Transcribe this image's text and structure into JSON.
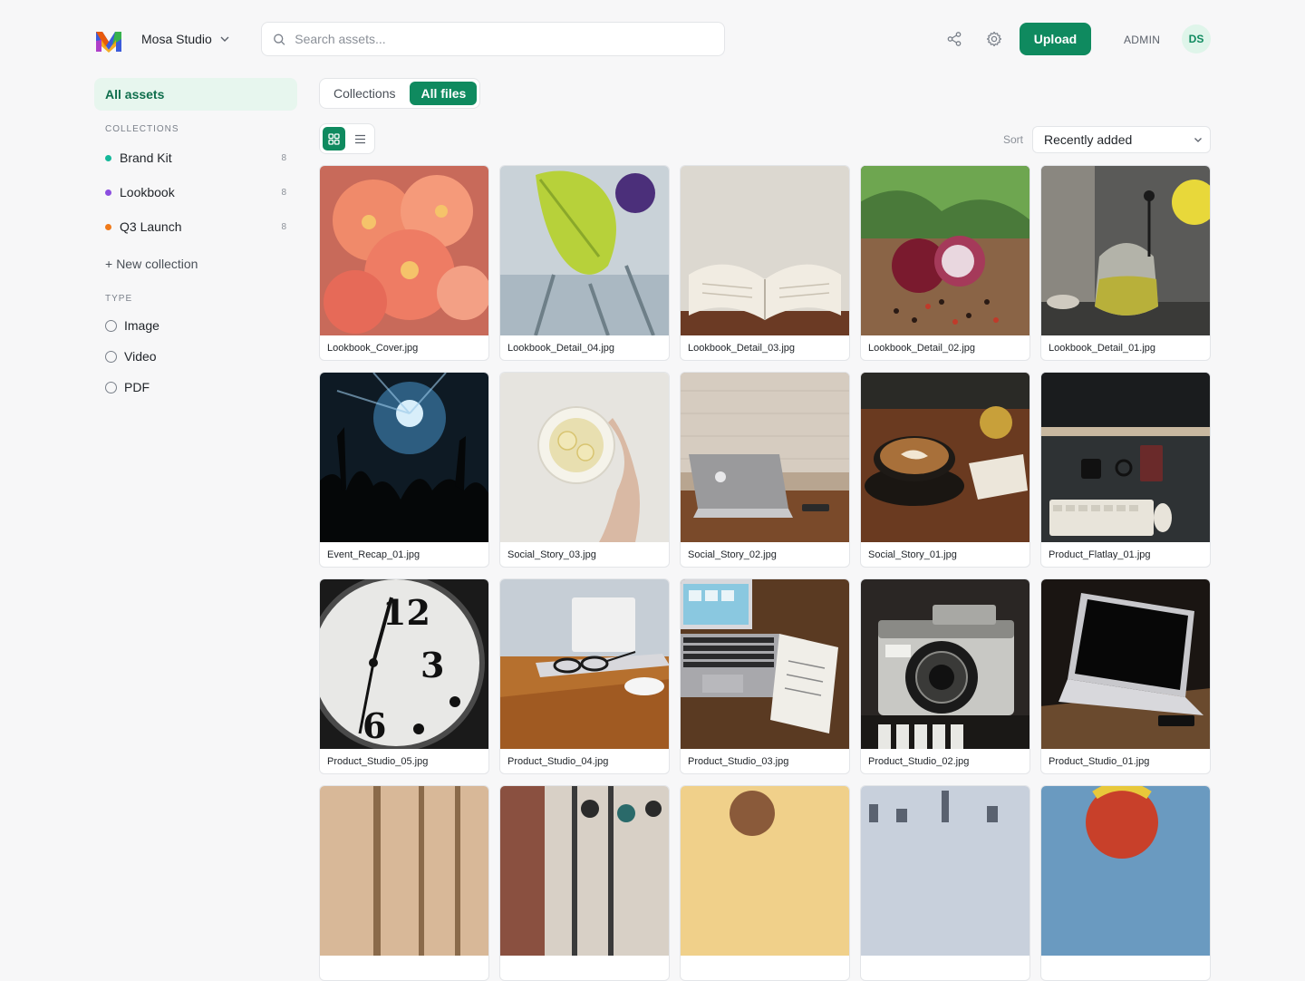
{
  "header": {
    "workspace_name": "Mosa Studio",
    "search_placeholder": "Search assets...",
    "upload_label": "Upload",
    "role": "ADMIN",
    "avatar_initials": "DS",
    "icons": [
      "share-icon",
      "settings-icon",
      "search-icon",
      "chevron-down-icon"
    ],
    "accent_color": "#0f8a5f"
  },
  "sidebar": {
    "all_assets": "All assets",
    "collections_heading": "COLLECTIONS",
    "collections": [
      {
        "name": "Brand Kit",
        "count": "8",
        "color": "#14b89a"
      },
      {
        "name": "Lookbook",
        "count": "8",
        "color": "#8b4ee0"
      },
      {
        "name": "Q3 Launch",
        "count": "8",
        "color": "#f07a1a"
      }
    ],
    "new_collection": "New collection",
    "type_heading": "TYPE",
    "types": [
      "Image",
      "Video",
      "PDF"
    ]
  },
  "main": {
    "tabs": [
      "Collections",
      "All files"
    ],
    "active_tab": "All files",
    "view_modes": [
      "grid-view-icon",
      "list-view-icon"
    ],
    "sort_label": "Sort",
    "sort_value": "Recently added",
    "files": [
      {
        "name": "Lookbook_Cover.jpg",
        "thumb": "flowers"
      },
      {
        "name": "Lookbook_Detail_04.jpg",
        "thumb": "leaf"
      },
      {
        "name": "Lookbook_Detail_03.jpg",
        "thumb": "book"
      },
      {
        "name": "Lookbook_Detail_02.jpg",
        "thumb": "onion"
      },
      {
        "name": "Lookbook_Detail_01.jpg",
        "thumb": "teapot"
      },
      {
        "name": "Event_Recap_01.jpg",
        "thumb": "concert"
      },
      {
        "name": "Social_Story_03.jpg",
        "thumb": "lemon"
      },
      {
        "name": "Social_Story_02.jpg",
        "thumb": "laptop-side"
      },
      {
        "name": "Social_Story_01.jpg",
        "thumb": "coffee"
      },
      {
        "name": "Product_Flatlay_01.jpg",
        "thumb": "desk"
      },
      {
        "name": "Product_Studio_05.jpg",
        "thumb": "clock"
      },
      {
        "name": "Product_Studio_04.jpg",
        "thumb": "glasses"
      },
      {
        "name": "Product_Studio_03.jpg",
        "thumb": "workspace"
      },
      {
        "name": "Product_Studio_02.jpg",
        "thumb": "camera"
      },
      {
        "name": "Product_Studio_01.jpg",
        "thumb": "macbook"
      },
      {
        "name": "",
        "thumb": "row4-a"
      },
      {
        "name": "",
        "thumb": "row4-b"
      },
      {
        "name": "",
        "thumb": "row4-c"
      },
      {
        "name": "",
        "thumb": "row4-d"
      },
      {
        "name": "",
        "thumb": "row4-e"
      }
    ]
  }
}
